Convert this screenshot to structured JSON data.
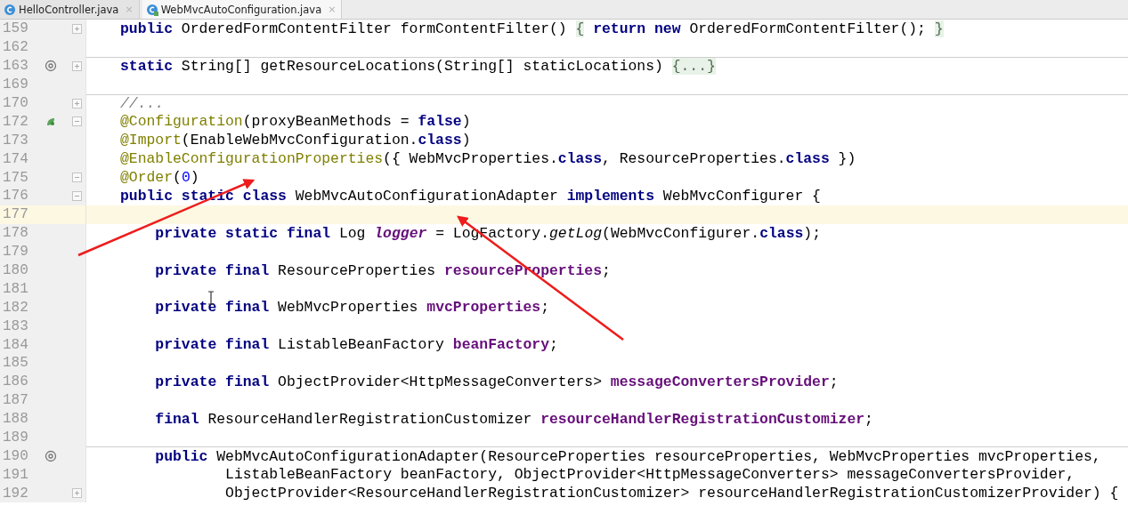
{
  "tabs": [
    {
      "label": "HelloController.java",
      "selected": false,
      "close": "×"
    },
    {
      "label": "WebMvcAutoConfiguration.java",
      "selected": true,
      "close": "×"
    }
  ],
  "lines": [
    {
      "number": "159",
      "collapsed": true,
      "tokens": [
        {
          "kind": "kw",
          "text": "public"
        },
        {
          "kind": "plain",
          "text": " OrderedFormContentFilter formContentFilter() "
        },
        {
          "kind": "fold",
          "text": "{"
        },
        {
          "kind": "kw",
          "text": " return new"
        },
        {
          "kind": "plain",
          "text": " OrderedFormContentFilter(); "
        },
        {
          "kind": "fold",
          "text": "}"
        }
      ]
    },
    {
      "number": "162"
    },
    {
      "number": "163",
      "override": true,
      "collapsed": true,
      "separator": true,
      "tokens": [
        {
          "kind": "kw",
          "text": "static"
        },
        {
          "kind": "plain",
          "text": " String[] getResourceLocations(String[] staticLocations) "
        },
        {
          "kind": "fold",
          "text": "{...}"
        }
      ]
    },
    {
      "number": "169"
    },
    {
      "number": "170",
      "collapsed": true,
      "separator": true,
      "tokens": [
        {
          "kind": "comment",
          "text": "//..."
        }
      ]
    },
    {
      "number": "172",
      "bean": true,
      "collapsed": false,
      "tokens": [
        {
          "kind": "ann",
          "text": "@Configuration"
        },
        {
          "kind": "plain",
          "text": "(proxyBeanMethods = "
        },
        {
          "kind": "kw",
          "text": "false"
        },
        {
          "kind": "plain",
          "text": ")"
        }
      ]
    },
    {
      "number": "173",
      "tokens": [
        {
          "kind": "ann",
          "text": "@Import"
        },
        {
          "kind": "plain",
          "text": "(EnableWebMvcConfiguration."
        },
        {
          "kind": "kw",
          "text": "class"
        },
        {
          "kind": "plain",
          "text": ")"
        }
      ]
    },
    {
      "number": "174",
      "tokens": [
        {
          "kind": "ann",
          "text": "@EnableConfigurationProperties"
        },
        {
          "kind": "plain",
          "text": "({ WebMvcProperties."
        },
        {
          "kind": "kw",
          "text": "class"
        },
        {
          "kind": "plain",
          "text": ", ResourceProperties."
        },
        {
          "kind": "kw",
          "text": "class"
        },
        {
          "kind": "plain",
          "text": " })"
        }
      ]
    },
    {
      "number": "175",
      "collapsed": false,
      "tokens": [
        {
          "kind": "ann",
          "text": "@Order"
        },
        {
          "kind": "plain",
          "text": "("
        },
        {
          "kind": "num",
          "text": "0"
        },
        {
          "kind": "plain",
          "text": ")"
        }
      ]
    },
    {
      "number": "176",
      "collapsed": false,
      "tokens": [
        {
          "kind": "kw",
          "text": "public static class"
        },
        {
          "kind": "plain",
          "text": " WebMvcAutoConfigurationAdapter "
        },
        {
          "kind": "kw",
          "text": "implements"
        },
        {
          "kind": "plain",
          "text": " WebMvcConfigurer {"
        }
      ]
    },
    {
      "number": "177",
      "current": true
    },
    {
      "number": "178",
      "nested": true,
      "tokens": [
        {
          "kind": "kw",
          "text": "private static final"
        },
        {
          "kind": "plain",
          "text": " Log "
        },
        {
          "kind": "static-field",
          "text": "logger"
        },
        {
          "kind": "plain",
          "text": " = LogFactory."
        },
        {
          "kind": "static-method",
          "text": "getLog"
        },
        {
          "kind": "plain",
          "text": "(WebMvcConfigurer."
        },
        {
          "kind": "kw",
          "text": "class"
        },
        {
          "kind": "plain",
          "text": ");"
        }
      ]
    },
    {
      "number": "179"
    },
    {
      "number": "180",
      "nested": true,
      "tokens": [
        {
          "kind": "kw",
          "text": "private final"
        },
        {
          "kind": "plain",
          "text": " ResourceProperties "
        },
        {
          "kind": "field",
          "text": "resourceProperties"
        },
        {
          "kind": "plain",
          "text": ";"
        }
      ]
    },
    {
      "number": "181"
    },
    {
      "number": "182",
      "nested": true,
      "tokens": [
        {
          "kind": "kw",
          "text": "private final"
        },
        {
          "kind": "plain",
          "text": " WebMvcProperties "
        },
        {
          "kind": "field",
          "text": "mvcProperties"
        },
        {
          "kind": "plain",
          "text": ";"
        }
      ]
    },
    {
      "number": "183"
    },
    {
      "number": "184",
      "nested": true,
      "tokens": [
        {
          "kind": "kw",
          "text": "private final"
        },
        {
          "kind": "plain",
          "text": " ListableBeanFactory "
        },
        {
          "kind": "field",
          "text": "beanFactory"
        },
        {
          "kind": "plain",
          "text": ";"
        }
      ]
    },
    {
      "number": "185"
    },
    {
      "number": "186",
      "nested": true,
      "tokens": [
        {
          "kind": "kw",
          "text": "private final"
        },
        {
          "kind": "plain",
          "text": " ObjectProvider<HttpMessageConverters> "
        },
        {
          "kind": "field",
          "text": "messageConvertersProvider"
        },
        {
          "kind": "plain",
          "text": ";"
        }
      ]
    },
    {
      "number": "187"
    },
    {
      "number": "188",
      "nested": true,
      "tokens": [
        {
          "kind": "kw",
          "text": "final"
        },
        {
          "kind": "plain",
          "text": " ResourceHandlerRegistrationCustomizer "
        },
        {
          "kind": "field",
          "text": "resourceHandlerRegistrationCustomizer"
        },
        {
          "kind": "plain",
          "text": ";"
        }
      ]
    },
    {
      "number": "189"
    },
    {
      "number": "190",
      "override": true,
      "nested": true,
      "separator": true,
      "tokens": [
        {
          "kind": "kw",
          "text": "public"
        },
        {
          "kind": "plain",
          "text": " WebMvcAutoConfigurationAdapter(ResourceProperties resourceProperties, WebMvcProperties mvcProperties,"
        }
      ]
    },
    {
      "number": "191",
      "nested": true,
      "continuation": true,
      "tokens": [
        {
          "kind": "plain",
          "text": "ListableBeanFactory beanFactory, ObjectProvider<HttpMessageConverters> messageConvertersProvider,"
        }
      ]
    },
    {
      "number": "192",
      "collapsed": true,
      "nested": true,
      "continuation": true,
      "tokens": [
        {
          "kind": "plain",
          "text": "ObjectProvider<ResourceHandlerRegistrationCustomizer> resourceHandlerRegistrationCustomizerProvider) {"
        }
      ]
    }
  ]
}
